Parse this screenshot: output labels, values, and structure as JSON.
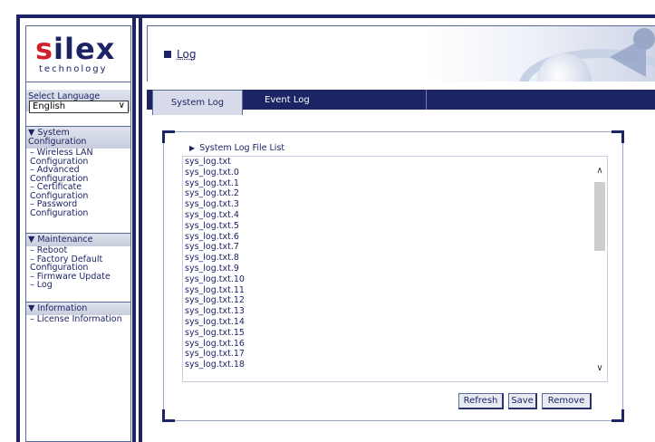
{
  "sidebar": {
    "logo_main": "silex",
    "logo_sub": "technology",
    "language_label": "Select Language",
    "language_value": "English",
    "sections": [
      {
        "title": "▼ System Configuration",
        "items": [
          "Wireless LAN Configuration",
          "Advanced Configuration",
          "Certificate Configuration",
          "Password Configuration"
        ]
      },
      {
        "title": "▼ Maintenance",
        "items": [
          "Reboot",
          "Factory Default Configuration",
          "Firmware Update",
          "Log"
        ]
      },
      {
        "title": "▼ Information",
        "items": [
          "License Information"
        ]
      }
    ]
  },
  "header": {
    "title": "Log"
  },
  "tabs": {
    "system_log": "System Log",
    "event_log": "Event Log"
  },
  "log_panel": {
    "list_title": "System Log File List",
    "files": [
      "sys_log.txt",
      "sys_log.txt.0",
      "sys_log.txt.1",
      "sys_log.txt.2",
      "sys_log.txt.3",
      "sys_log.txt.4",
      "sys_log.txt.5",
      "sys_log.txt.6",
      "sys_log.txt.7",
      "sys_log.txt.8",
      "sys_log.txt.9",
      "sys_log.txt.10",
      "sys_log.txt.11",
      "sys_log.txt.12",
      "sys_log.txt.13",
      "sys_log.txt.14",
      "sys_log.txt.15",
      "sys_log.txt.16",
      "sys_log.txt.17",
      "sys_log.txt.18"
    ],
    "buttons": {
      "refresh": "Refresh",
      "save": "Save",
      "remove": "Remove"
    }
  }
}
